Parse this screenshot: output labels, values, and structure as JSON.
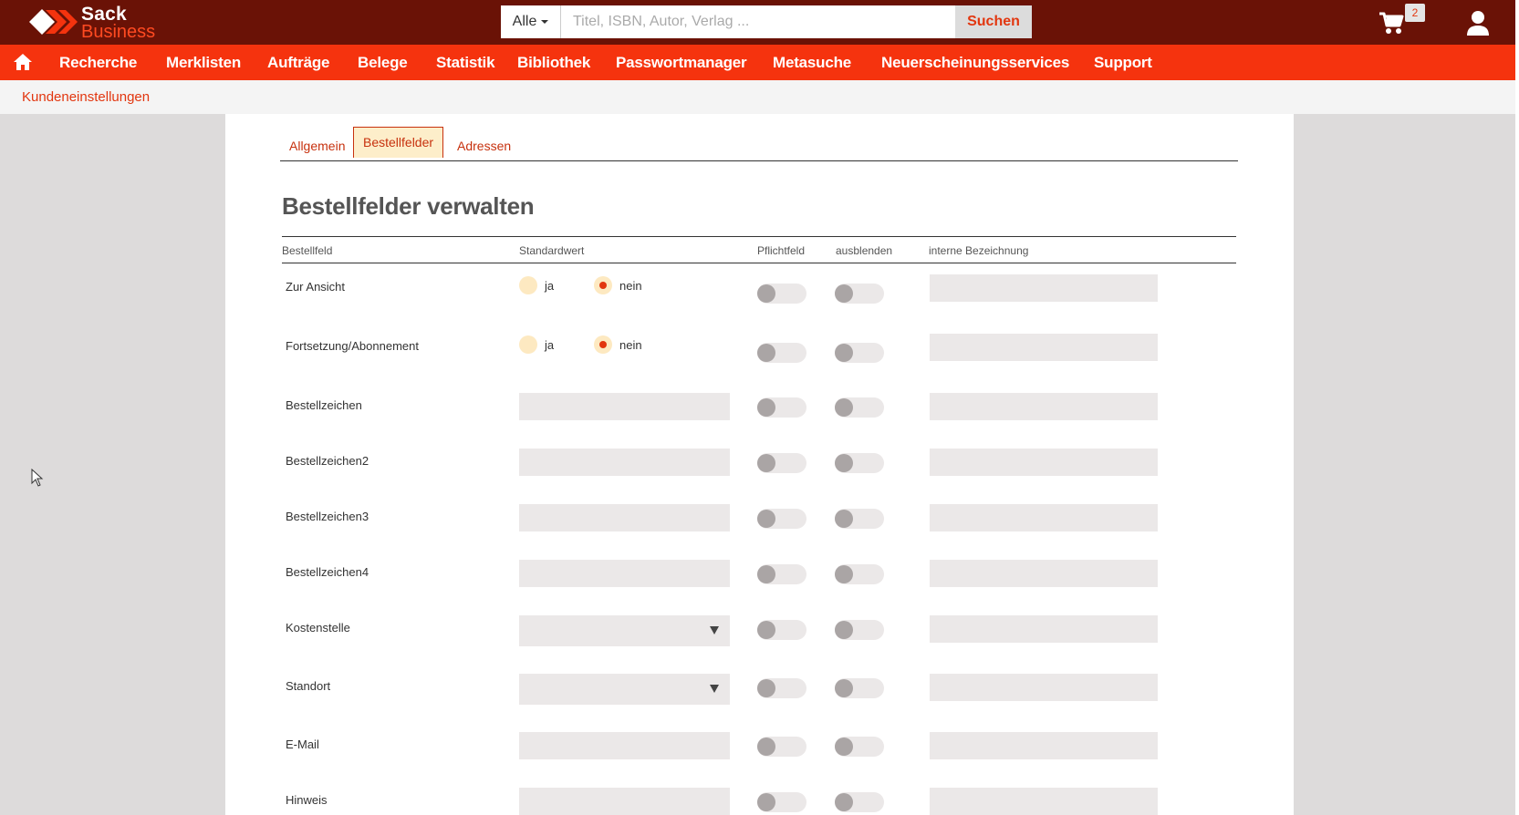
{
  "header": {
    "logo_sack": "Sack",
    "logo_business": "Business",
    "search_scope": "Alle",
    "search_placeholder": "Titel, ISBN, Autor, Verlag ...",
    "search_button": "Suchen",
    "cart_count": "2",
    "icons": [
      "logo-mark",
      "cart-icon",
      "user-icon"
    ]
  },
  "nav": {
    "home_icon": "home-icon",
    "items": [
      "Recherche",
      "Merklisten",
      "Aufträge",
      "Belege",
      "Statistik",
      "Bibliothek",
      "Passwortmanager",
      "Metasuche",
      "Neuerscheinungsservices",
      "Support"
    ]
  },
  "subheader": {
    "title": "Kundeneinstellungen"
  },
  "tabs": [
    {
      "label": "Allgemein",
      "active": false
    },
    {
      "label": "Bestellfelder",
      "active": true
    },
    {
      "label": "Adressen",
      "active": false
    }
  ],
  "page_title": "Bestellfelder verwalten",
  "table": {
    "columns": [
      "Bestellfeld",
      "Standardwert",
      "Pflichtfeld",
      "ausblenden",
      "interne Bezeichnung"
    ],
    "radio_yes": "ja",
    "radio_no": "nein",
    "rows": [
      {
        "label": "Zur Ansicht",
        "type": "radio",
        "value": "nein",
        "required": false,
        "hidden": false
      },
      {
        "label": "Fortsetzung/Abonnement",
        "type": "radio",
        "value": "nein",
        "required": false,
        "hidden": false
      },
      {
        "label": "Bestellzeichen",
        "type": "text",
        "value": "",
        "required": false,
        "hidden": false
      },
      {
        "label": "Bestellzeichen2",
        "type": "text",
        "value": "",
        "required": false,
        "hidden": false
      },
      {
        "label": "Bestellzeichen3",
        "type": "text",
        "value": "",
        "required": false,
        "hidden": false
      },
      {
        "label": "Bestellzeichen4",
        "type": "text",
        "value": "",
        "required": false,
        "hidden": false
      },
      {
        "label": "Kostenstelle",
        "type": "select",
        "value": "",
        "required": false,
        "hidden": false
      },
      {
        "label": "Standort",
        "type": "select",
        "value": "",
        "required": false,
        "hidden": false
      },
      {
        "label": "E-Mail",
        "type": "text",
        "value": "",
        "required": false,
        "hidden": false
      },
      {
        "label": "Hinweis",
        "type": "text",
        "value": "",
        "required": false,
        "hidden": false
      }
    ]
  },
  "colors": {
    "topbar": "#6a1206",
    "nav": "#f5330e",
    "accent": "#e2360f",
    "tab_active_bg": "#fdeeca",
    "field_bg": "#ebe8e8"
  }
}
